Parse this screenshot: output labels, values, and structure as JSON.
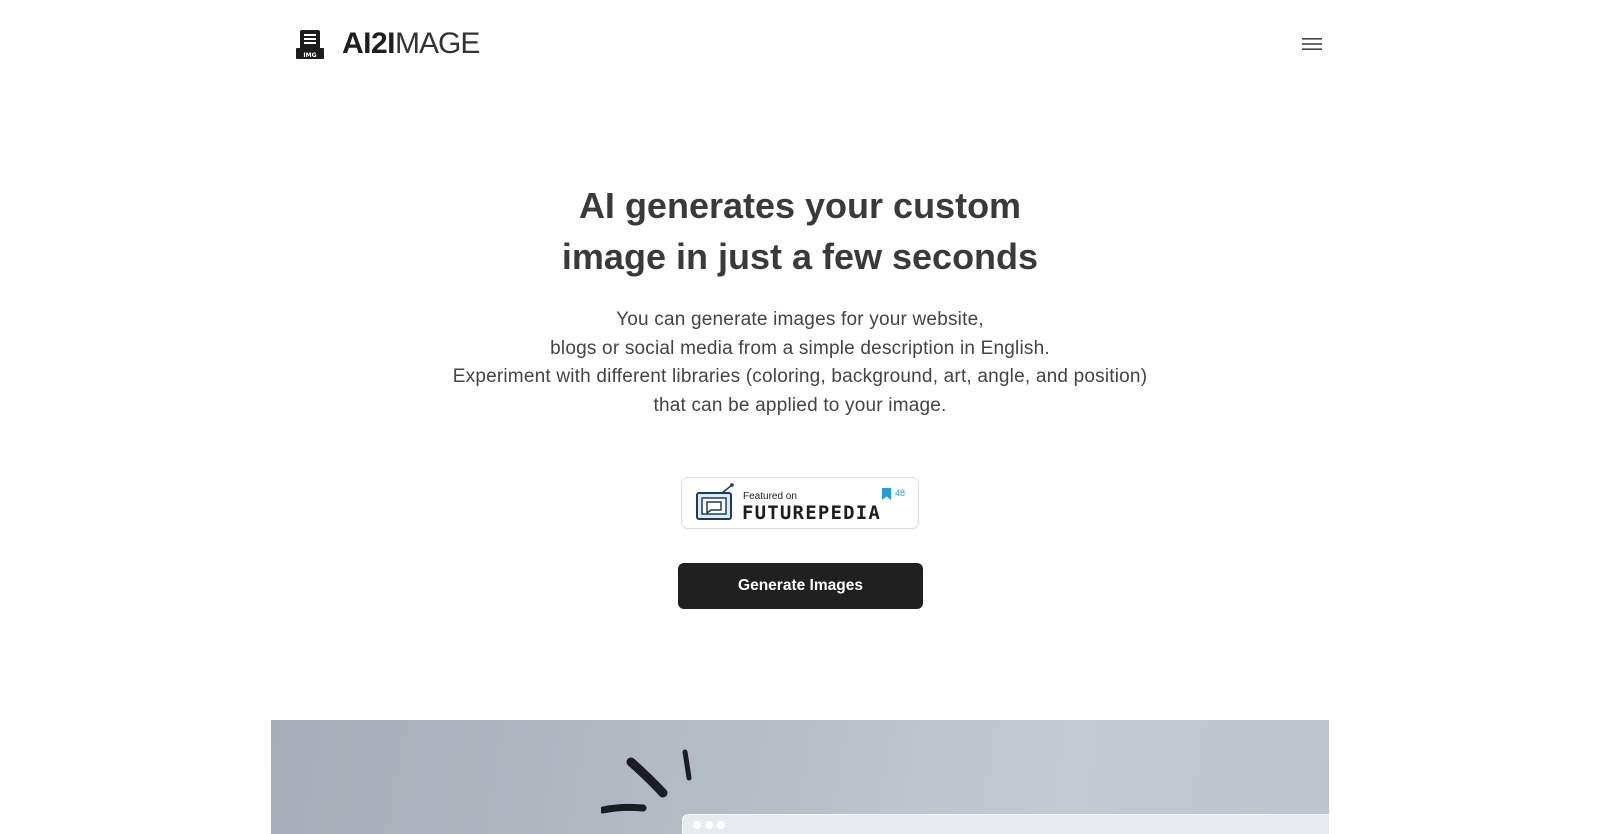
{
  "header": {
    "logo_bold": "AI2I",
    "logo_light": "MAGE",
    "logo_icon": "document-img-icon",
    "menu_icon": "hamburger-menu-icon"
  },
  "hero": {
    "title_lines": [
      "AI generates your custom",
      "image in just a few seconds"
    ],
    "description_lines": [
      "You can generate images for your website,",
      "blogs or social media from a simple description in English.",
      "Experiment with different libraries (coloring, background, art, angle, and position)",
      "that can be applied to your image."
    ]
  },
  "badge": {
    "small_text": "Featured on",
    "big_text": "FUTUREPEDIA",
    "count": "48",
    "accent_color": "#1ea0d8"
  },
  "cta": {
    "label": "Generate Images"
  },
  "colors": {
    "text": "#333333",
    "button_bg": "#202020",
    "button_text": "#ffffff"
  }
}
